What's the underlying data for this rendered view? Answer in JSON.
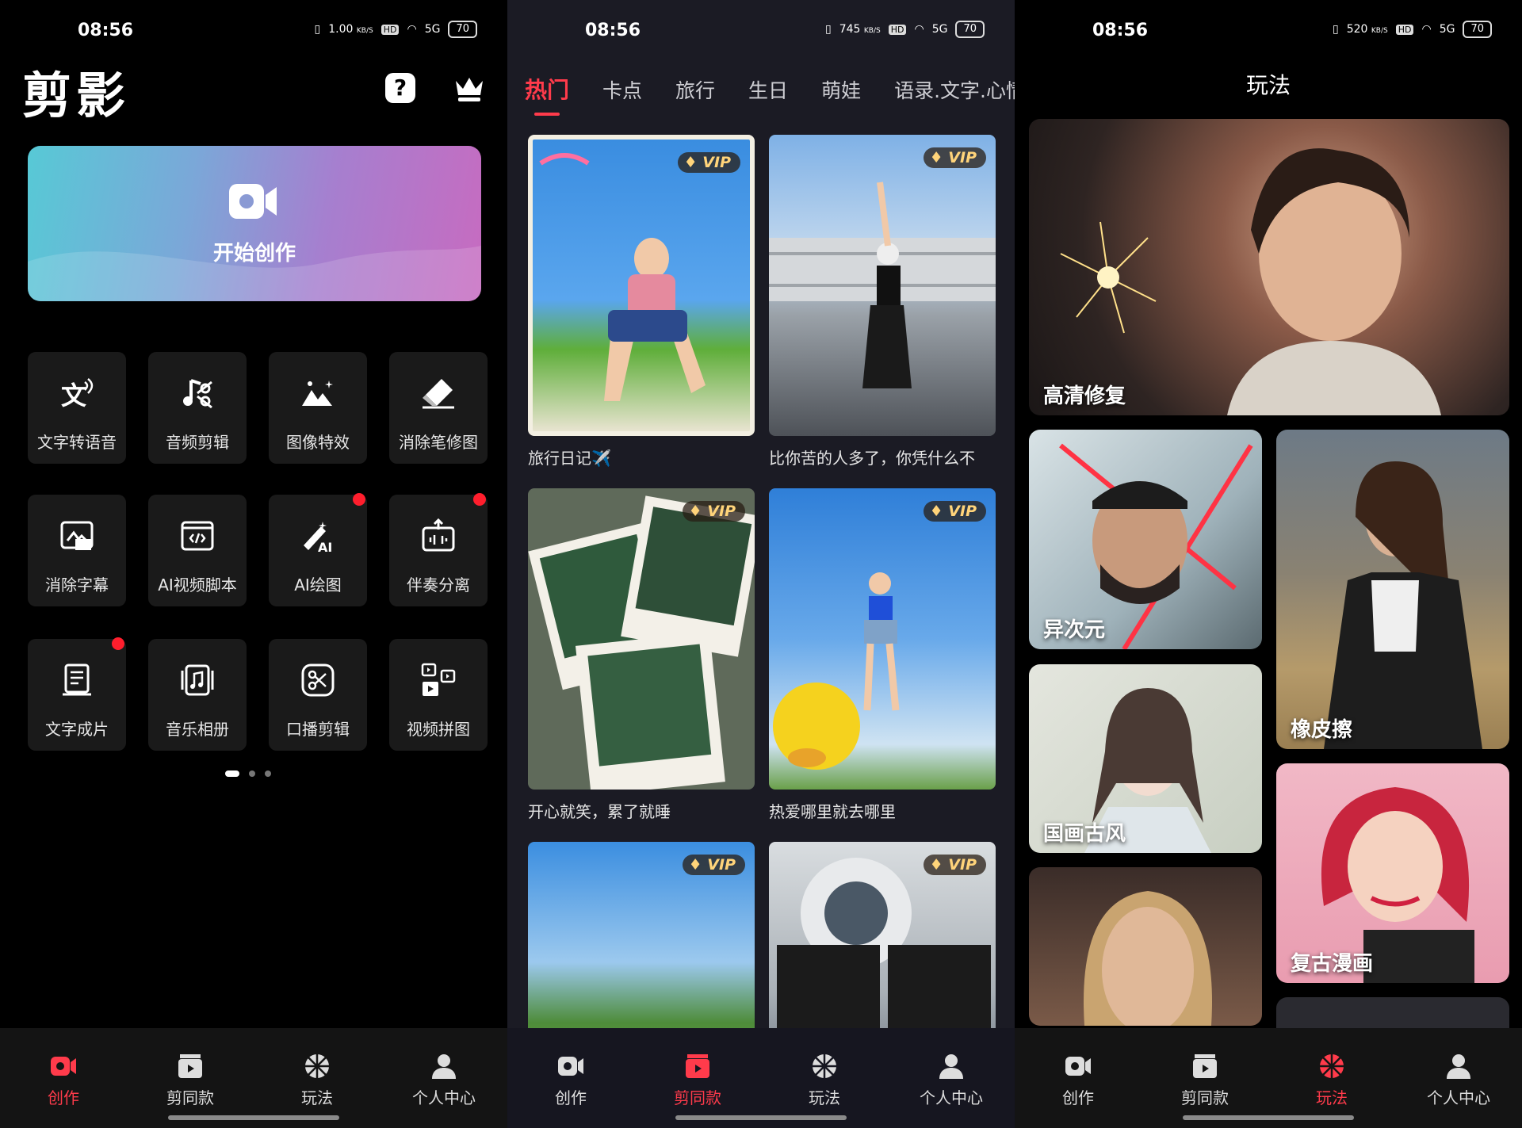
{
  "status": {
    "time": "08:56",
    "net_speeds": [
      "1.00",
      "745",
      "520"
    ],
    "net_unit": "KB/S",
    "hd": "HD",
    "signal": "5G",
    "battery": "70"
  },
  "create": {
    "logo": "剪影",
    "hero_label": "开始创作",
    "tools": [
      {
        "label": "文字转语音",
        "icon": "text-to-speech-icon",
        "dot": false
      },
      {
        "label": "音频剪辑",
        "icon": "audio-edit-icon",
        "dot": false
      },
      {
        "label": "图像特效",
        "icon": "image-effects-icon",
        "dot": false
      },
      {
        "label": "消除笔修图",
        "icon": "eraser-icon",
        "dot": false
      },
      {
        "label": "消除字幕",
        "icon": "remove-subtitle-icon",
        "dot": false
      },
      {
        "label": "AI视频脚本",
        "icon": "ai-script-icon",
        "dot": false
      },
      {
        "label": "AI绘图",
        "icon": "ai-draw-icon",
        "dot": true
      },
      {
        "label": "伴奏分离",
        "icon": "accompaniment-icon",
        "dot": true
      },
      {
        "label": "文字成片",
        "icon": "text-to-video-icon",
        "dot": true
      },
      {
        "label": "音乐相册",
        "icon": "music-album-icon",
        "dot": false
      },
      {
        "label": "口播剪辑",
        "icon": "speech-edit-icon",
        "dot": false
      },
      {
        "label": "视频拼图",
        "icon": "video-collage-icon",
        "dot": false
      }
    ]
  },
  "templates": {
    "categories": [
      "热门",
      "卡点",
      "旅行",
      "生日",
      "萌娃",
      "语录.文字.心情"
    ],
    "vip_label": "VIP",
    "cards": [
      {
        "caption": "旅行日记✈️"
      },
      {
        "caption": "比你苦的人多了，你凭什么不"
      },
      {
        "caption": "开心就笑，累了就睡"
      },
      {
        "caption": "热爱哪里就去哪里"
      },
      {
        "caption": ""
      },
      {
        "caption": ""
      }
    ]
  },
  "play": {
    "title": "玩法",
    "items": [
      "高清修复",
      "异次元",
      "橡皮擦",
      "国画古风",
      "复古漫画"
    ]
  },
  "tabs": [
    "创作",
    "剪同款",
    "玩法",
    "个人中心"
  ],
  "colors": {
    "accent": "#ff3b4b",
    "background": "#000000",
    "panel2_bg": "#1b1b24",
    "vip": "#ffd47a"
  }
}
